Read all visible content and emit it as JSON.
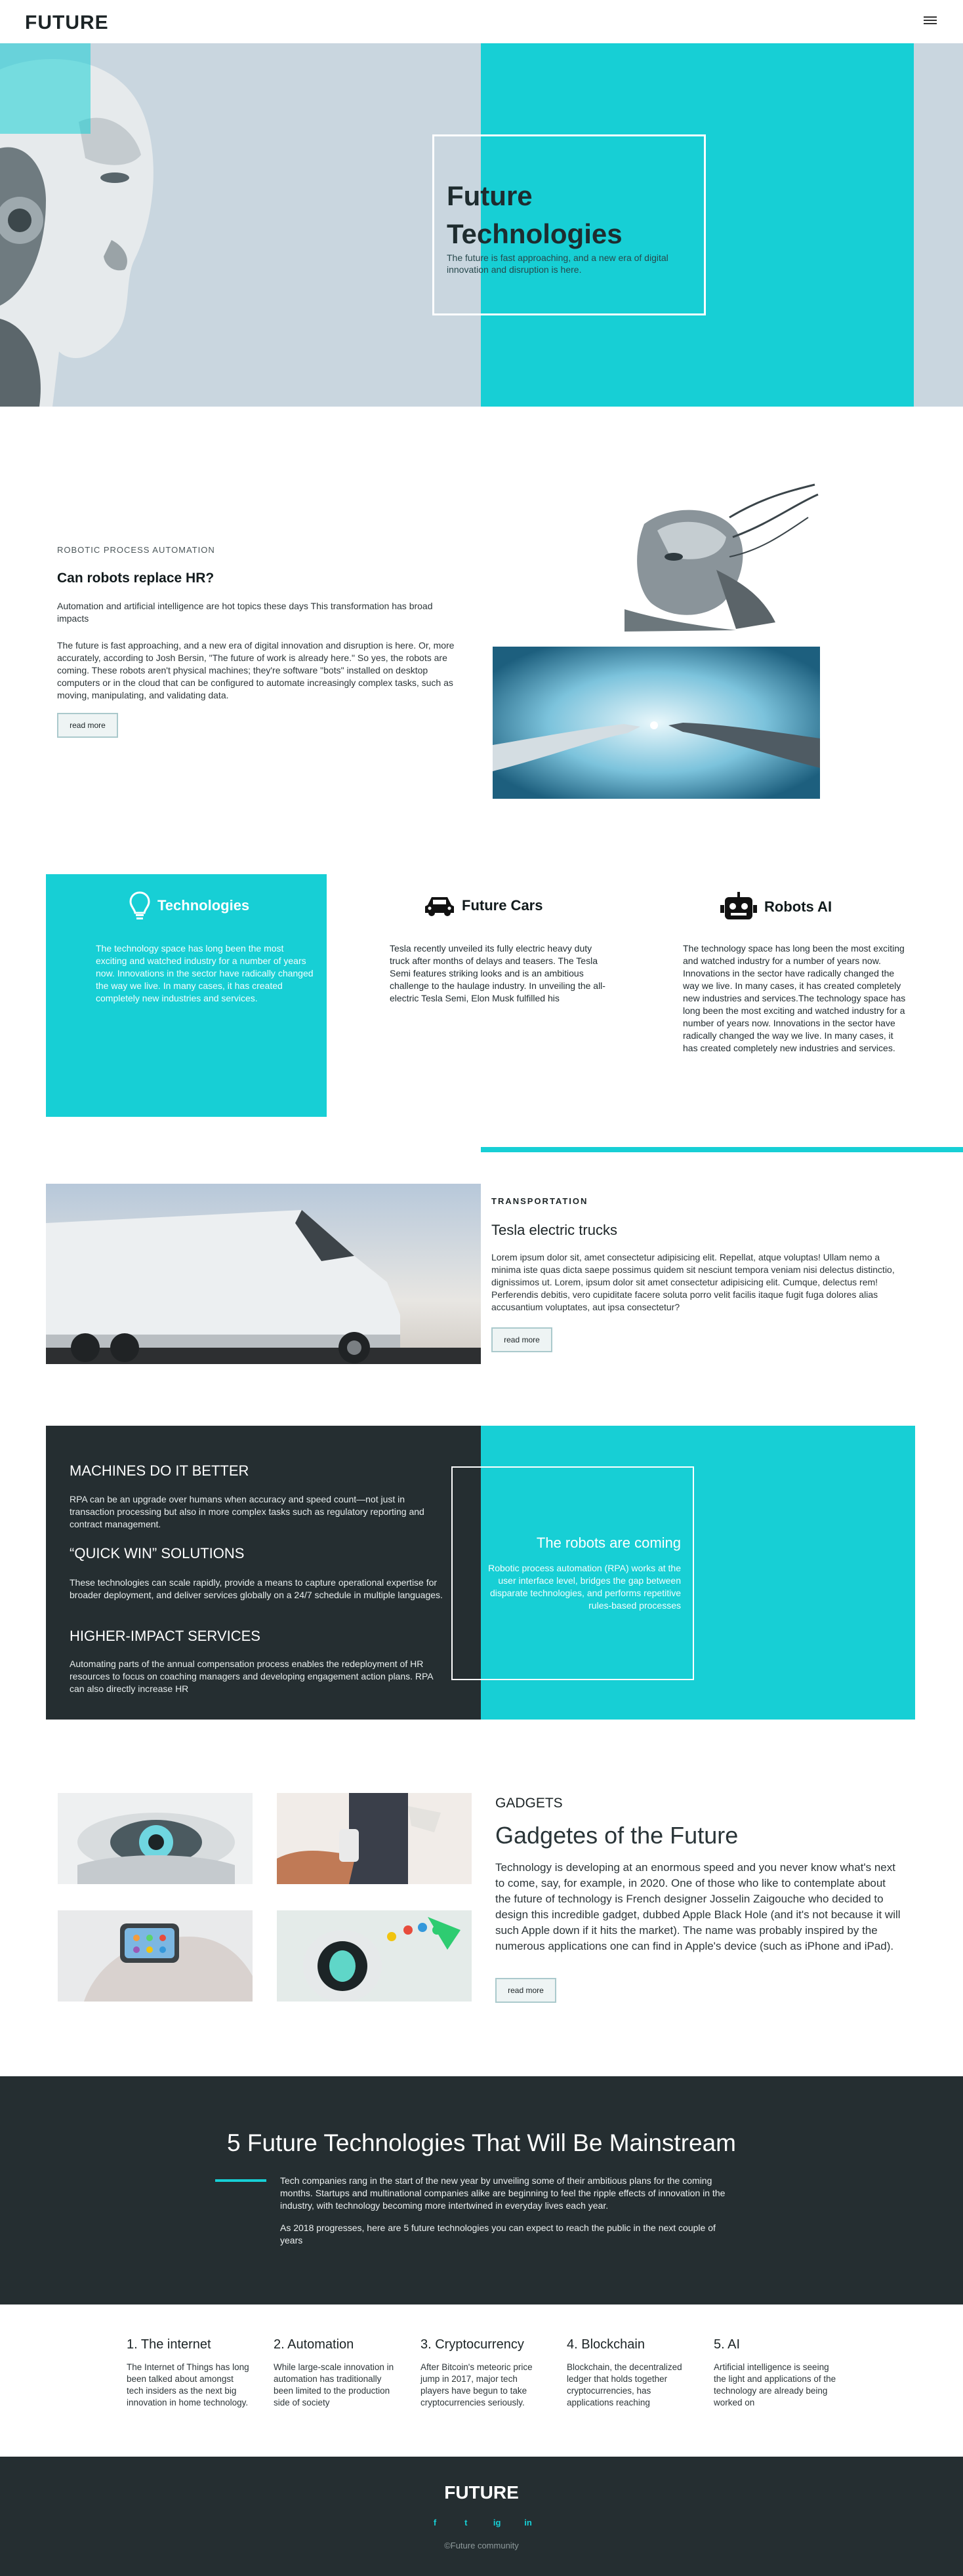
{
  "header": {
    "brand": "FUTURE",
    "menu_icon": "hamburger-icon"
  },
  "hero": {
    "title": "Future Technologies",
    "subtitle": "The future is fast approaching, and a new era of digital innovation and disruption is here."
  },
  "rpa": {
    "eyebrow": "ROBOTIC PROCESS AUTOMATION",
    "title": "Can robots replace HR?",
    "p1": "Automation and artificial intelligence are hot topics these days This transformation has broad impacts",
    "p2": "The future is fast approaching, and a new era of digital innovation and disruption is here. Or, more accurately, according to Josh Bersin, \"The future of work is already here.\" So yes, the robots are coming. These robots aren't physical machines; they're software \"bots\" installed on desktop computers or in the cloud that can be configured to automate increasingly complex tasks, such as moving, manipulating, and validating data.",
    "button": "read more"
  },
  "features": [
    {
      "title": "Technologies",
      "icon": "lightbulb-icon",
      "text": "The technology space has long been the most exciting and watched industry for a number of years now. Innovations in the sector have radically changed the way we live. In many cases, it has created completely new industries and services."
    },
    {
      "title": "Future Cars",
      "icon": "car-icon",
      "text": "Tesla recently unveiled its fully electric heavy duty truck after months of delays and teasers. The Tesla Semi features striking looks and is an ambitious challenge to the haulage industry. In unveiling the all-electric Tesla Semi, Elon Musk fulfilled his"
    },
    {
      "title": "Robots AI",
      "icon": "robot-icon",
      "text": "The technology space has long been the most exciting and watched industry for a number of years now. Innovations in the sector have radically changed the way we live. In many cases, it has created completely new industries and services.The technology space has long been the most exciting and watched industry for a number of years now. Innovations in the sector have radically changed the way we live. In many cases, it has created completely new industries and services."
    }
  ],
  "transport": {
    "eyebrow": "TRANSPORTATION",
    "title": "Tesla electric trucks",
    "text": "Lorem ipsum dolor sit, amet consectetur adipisicing elit. Repellat, atque voluptas! Ullam nemo a minima iste quas dicta saepe possimus quidem sit nesciunt tempora veniam nisi delectus distinctio, dignissimos ut. Lorem, ipsum dolor sit amet consectetur adipisicing elit. Cumque, delectus rem! Perferendis debitis, vero cupiditate facere soluta porro velit facilis itaque fugit fuga dolores alias accusantium voluptates, aut ipsa consectetur?",
    "button": "read more"
  },
  "machines": {
    "h1": "MACHINES DO IT BETTER",
    "p1": "RPA can be an upgrade over humans when accuracy and speed count—not just in transaction processing but also in more complex tasks such as regulatory reporting and contract management.",
    "h2": "“QUICK WIN” SOLUTIONS",
    "p2": "These technologies can scale rapidly, provide a means to capture operational expertise for broader deployment, and deliver services globally on a 24/7 schedule in multiple languages.",
    "h3": "HIGHER-IMPACT SERVICES",
    "p3": "Automating parts of the annual compensation process enables the redeployment of HR resources to focus on coaching managers and developing engagement action plans. RPA can also directly increase HR",
    "coming_title": "The robots are coming",
    "coming_text": "Robotic process automation (RPA) works at the user interface level, bridges the gap between disparate technologies, and performs repetitive rules-based processes"
  },
  "gadgets": {
    "eyebrow": "GADGETS",
    "title": "Gadgetes of the Future",
    "text": "Technology is developing at an enormous speed and you never know what's next to come, say, for example, in 2020. One of those who like to contemplate about the future of technology is French designer Josselin Zaigouche who decided to design this incredible gadget, dubbed Apple Black Hole (and it's not because it will such Apple down if it hits the market). The name was probably inspired by the numerous applications one can find in Apple's device (such as iPhone and iPad).",
    "button": "read more"
  },
  "mainstream": {
    "title": "5 Future Technologies That Will Be Mainstream",
    "p1": "Tech companies rang in the start of the new year by unveiling some of their ambitious plans for the coming months. Startups and multinational companies alike are beginning to feel the ripple effects of innovation in the industry, with technology becoming more intertwined in everyday lives each year.",
    "p2": "As 2018 progresses, here are 5 future technologies you can expect to reach the public in the next couple of years"
  },
  "techs": [
    {
      "title": "1. The internet",
      "text": "The Internet of Things has long been talked about amongst tech insiders as the next big innovation in home technology."
    },
    {
      "title": "2. Automation",
      "text": "While large-scale innovation in automation has traditionally been limited to the production side of society"
    },
    {
      "title": "3. Cryptocurrency",
      "text": "After Bitcoin's meteoric price jump in 2017, major tech players have begun to take cryptocurrencies seriously."
    },
    {
      "title": "4. Blockchain",
      "text": "Blockchain, the decentralized ledger that holds together cryptocurrencies, has applications reaching"
    },
    {
      "title": "5. AI",
      "text": "Artificial intelligence is seeing the light and applications of the technology are already being worked on"
    }
  ],
  "footer": {
    "brand": "FUTURE",
    "socials": [
      "f",
      "t",
      "ig",
      "in"
    ],
    "social_icons": [
      "facebook-icon",
      "twitter-icon",
      "instagram-icon",
      "linkedin-icon"
    ],
    "copyright": "©Future community"
  },
  "colors": {
    "accent": "#17cfd5",
    "dark": "#252e31",
    "hero_bg": "#c9d6df"
  }
}
